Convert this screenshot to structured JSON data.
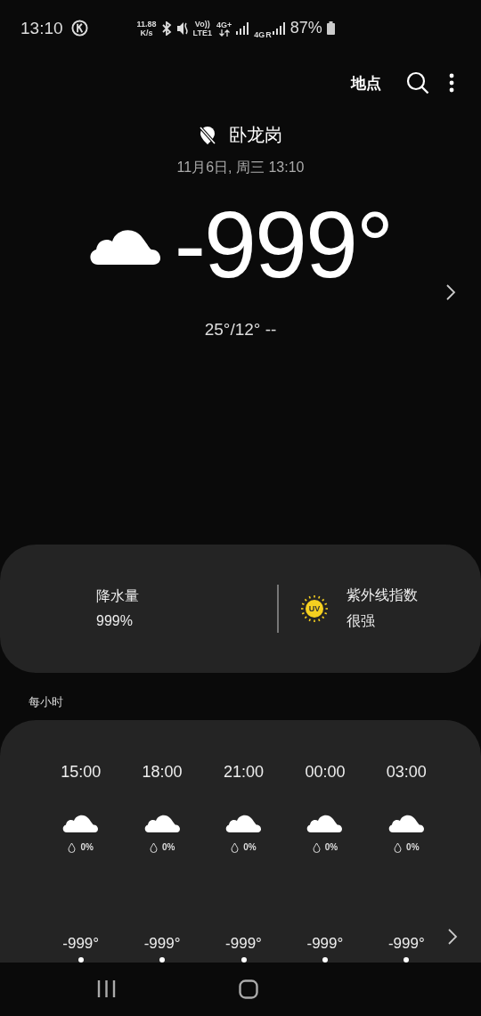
{
  "status_bar": {
    "time": "13:10",
    "speed_value": "11.88",
    "speed_unit": "K/s",
    "volte_top": "Vo))",
    "volte_bottom": "LTE1",
    "network_1": "4G+",
    "network_2": "4G",
    "roaming": "R",
    "battery": "87%"
  },
  "toolbar": {
    "locations_label": "地点"
  },
  "location": {
    "name": "卧龙岗",
    "datetime": "11月6日, 周三 13:10"
  },
  "current": {
    "temperature": "-999°",
    "high_low": "25°/12° --"
  },
  "details": [
    {
      "kind": "precipitation",
      "label": "降水量",
      "value": "999%"
    },
    {
      "kind": "uv",
      "label": "紫外线指数",
      "value": "很强",
      "badge": "UV"
    }
  ],
  "hourly": {
    "title": "每小时",
    "items": [
      {
        "time": "15:00",
        "precipitation": "0%",
        "temperature": "-999°"
      },
      {
        "time": "18:00",
        "precipitation": "0%",
        "temperature": "-999°"
      },
      {
        "time": "21:00",
        "precipitation": "0%",
        "temperature": "-999°"
      },
      {
        "time": "00:00",
        "precipitation": "0%",
        "temperature": "-999°"
      },
      {
        "time": "03:00",
        "precipitation": "0%",
        "temperature": "-999°"
      }
    ]
  }
}
